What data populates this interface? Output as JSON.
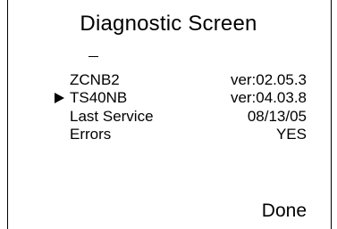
{
  "screen": {
    "title": "Diagnostic Screen"
  },
  "items": [
    {
      "label": "ZCNB2",
      "value": "ver:02.05.3",
      "selected": false
    },
    {
      "label": "TS40NB",
      "value": "ver:04.03.8",
      "selected": true
    },
    {
      "label": "Last Service",
      "value": "08/13/05",
      "selected": false
    },
    {
      "label": "Errors",
      "value": "YES",
      "selected": false
    }
  ],
  "actions": {
    "done_label": "Done"
  },
  "icons": {
    "selection_pointer": "right-triangle-pointer-icon"
  },
  "colors": {
    "background": "#ffffff",
    "foreground": "#000000"
  }
}
